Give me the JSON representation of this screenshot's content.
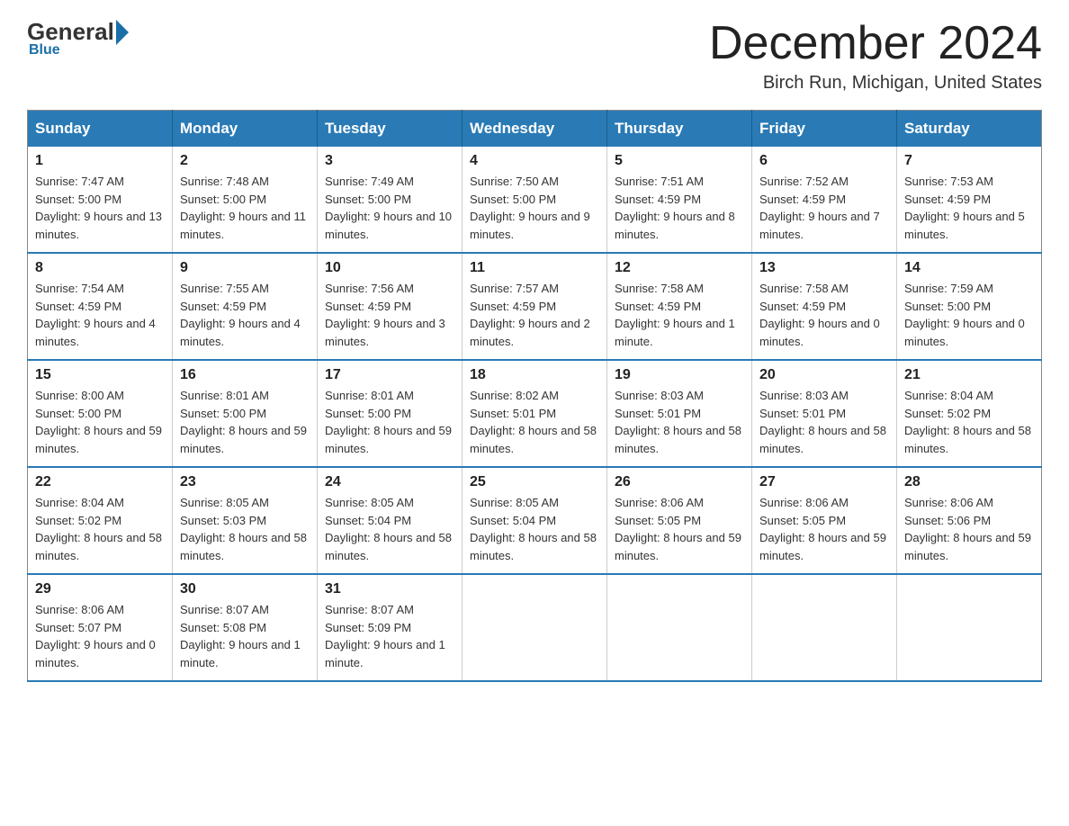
{
  "header": {
    "logo_general": "General",
    "logo_blue": "Blue",
    "month_title": "December 2024",
    "location": "Birch Run, Michigan, United States"
  },
  "days_of_week": [
    "Sunday",
    "Monday",
    "Tuesday",
    "Wednesday",
    "Thursday",
    "Friday",
    "Saturday"
  ],
  "weeks": [
    [
      {
        "day": "1",
        "sunrise": "7:47 AM",
        "sunset": "5:00 PM",
        "daylight": "9 hours and 13 minutes."
      },
      {
        "day": "2",
        "sunrise": "7:48 AM",
        "sunset": "5:00 PM",
        "daylight": "9 hours and 11 minutes."
      },
      {
        "day": "3",
        "sunrise": "7:49 AM",
        "sunset": "5:00 PM",
        "daylight": "9 hours and 10 minutes."
      },
      {
        "day": "4",
        "sunrise": "7:50 AM",
        "sunset": "5:00 PM",
        "daylight": "9 hours and 9 minutes."
      },
      {
        "day": "5",
        "sunrise": "7:51 AM",
        "sunset": "4:59 PM",
        "daylight": "9 hours and 8 minutes."
      },
      {
        "day": "6",
        "sunrise": "7:52 AM",
        "sunset": "4:59 PM",
        "daylight": "9 hours and 7 minutes."
      },
      {
        "day": "7",
        "sunrise": "7:53 AM",
        "sunset": "4:59 PM",
        "daylight": "9 hours and 5 minutes."
      }
    ],
    [
      {
        "day": "8",
        "sunrise": "7:54 AM",
        "sunset": "4:59 PM",
        "daylight": "9 hours and 4 minutes."
      },
      {
        "day": "9",
        "sunrise": "7:55 AM",
        "sunset": "4:59 PM",
        "daylight": "9 hours and 4 minutes."
      },
      {
        "day": "10",
        "sunrise": "7:56 AM",
        "sunset": "4:59 PM",
        "daylight": "9 hours and 3 minutes."
      },
      {
        "day": "11",
        "sunrise": "7:57 AM",
        "sunset": "4:59 PM",
        "daylight": "9 hours and 2 minutes."
      },
      {
        "day": "12",
        "sunrise": "7:58 AM",
        "sunset": "4:59 PM",
        "daylight": "9 hours and 1 minute."
      },
      {
        "day": "13",
        "sunrise": "7:58 AM",
        "sunset": "4:59 PM",
        "daylight": "9 hours and 0 minutes."
      },
      {
        "day": "14",
        "sunrise": "7:59 AM",
        "sunset": "5:00 PM",
        "daylight": "9 hours and 0 minutes."
      }
    ],
    [
      {
        "day": "15",
        "sunrise": "8:00 AM",
        "sunset": "5:00 PM",
        "daylight": "8 hours and 59 minutes."
      },
      {
        "day": "16",
        "sunrise": "8:01 AM",
        "sunset": "5:00 PM",
        "daylight": "8 hours and 59 minutes."
      },
      {
        "day": "17",
        "sunrise": "8:01 AM",
        "sunset": "5:00 PM",
        "daylight": "8 hours and 59 minutes."
      },
      {
        "day": "18",
        "sunrise": "8:02 AM",
        "sunset": "5:01 PM",
        "daylight": "8 hours and 58 minutes."
      },
      {
        "day": "19",
        "sunrise": "8:03 AM",
        "sunset": "5:01 PM",
        "daylight": "8 hours and 58 minutes."
      },
      {
        "day": "20",
        "sunrise": "8:03 AM",
        "sunset": "5:01 PM",
        "daylight": "8 hours and 58 minutes."
      },
      {
        "day": "21",
        "sunrise": "8:04 AM",
        "sunset": "5:02 PM",
        "daylight": "8 hours and 58 minutes."
      }
    ],
    [
      {
        "day": "22",
        "sunrise": "8:04 AM",
        "sunset": "5:02 PM",
        "daylight": "8 hours and 58 minutes."
      },
      {
        "day": "23",
        "sunrise": "8:05 AM",
        "sunset": "5:03 PM",
        "daylight": "8 hours and 58 minutes."
      },
      {
        "day": "24",
        "sunrise": "8:05 AM",
        "sunset": "5:04 PM",
        "daylight": "8 hours and 58 minutes."
      },
      {
        "day": "25",
        "sunrise": "8:05 AM",
        "sunset": "5:04 PM",
        "daylight": "8 hours and 58 minutes."
      },
      {
        "day": "26",
        "sunrise": "8:06 AM",
        "sunset": "5:05 PM",
        "daylight": "8 hours and 59 minutes."
      },
      {
        "day": "27",
        "sunrise": "8:06 AM",
        "sunset": "5:05 PM",
        "daylight": "8 hours and 59 minutes."
      },
      {
        "day": "28",
        "sunrise": "8:06 AM",
        "sunset": "5:06 PM",
        "daylight": "8 hours and 59 minutes."
      }
    ],
    [
      {
        "day": "29",
        "sunrise": "8:06 AM",
        "sunset": "5:07 PM",
        "daylight": "9 hours and 0 minutes."
      },
      {
        "day": "30",
        "sunrise": "8:07 AM",
        "sunset": "5:08 PM",
        "daylight": "9 hours and 1 minute."
      },
      {
        "day": "31",
        "sunrise": "8:07 AM",
        "sunset": "5:09 PM",
        "daylight": "9 hours and 1 minute."
      },
      null,
      null,
      null,
      null
    ]
  ],
  "labels": {
    "sunrise": "Sunrise:",
    "sunset": "Sunset:",
    "daylight": "Daylight:"
  }
}
